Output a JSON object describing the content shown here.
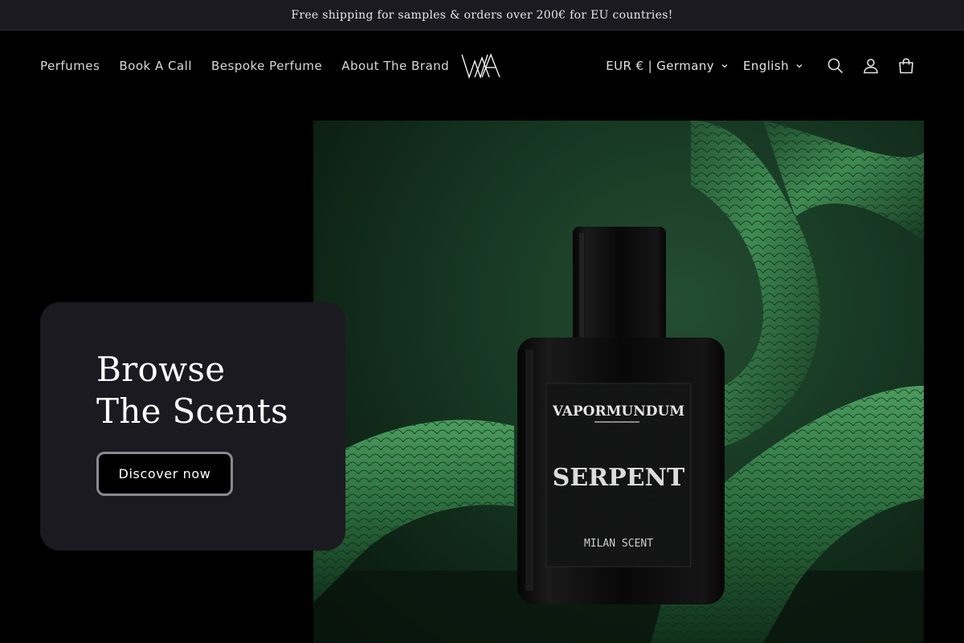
{
  "announcement": {
    "text": "Free shipping for samples & orders over 200€ for EU countries!"
  },
  "nav": {
    "items": [
      {
        "label": "Perfumes"
      },
      {
        "label": "Book A Call"
      },
      {
        "label": "Bespoke Perfume"
      },
      {
        "label": "About The Brand"
      }
    ]
  },
  "header": {
    "country_selector": "EUR € | Germany",
    "language_selector": "English",
    "icons": [
      "search-icon",
      "account-icon",
      "cart-icon"
    ]
  },
  "hero": {
    "title": "Browse The Scents",
    "button_label": "Discover now",
    "bottle": {
      "brand": "VAPORMUNDUM",
      "name": "SERPENT",
      "subtitle": "MILAN SCENT"
    }
  },
  "colors": {
    "background": "#000000",
    "announcement_bg": "#1b1a20",
    "card_bg": "#1b1a20",
    "accent_green": "#2b5b3a"
  }
}
